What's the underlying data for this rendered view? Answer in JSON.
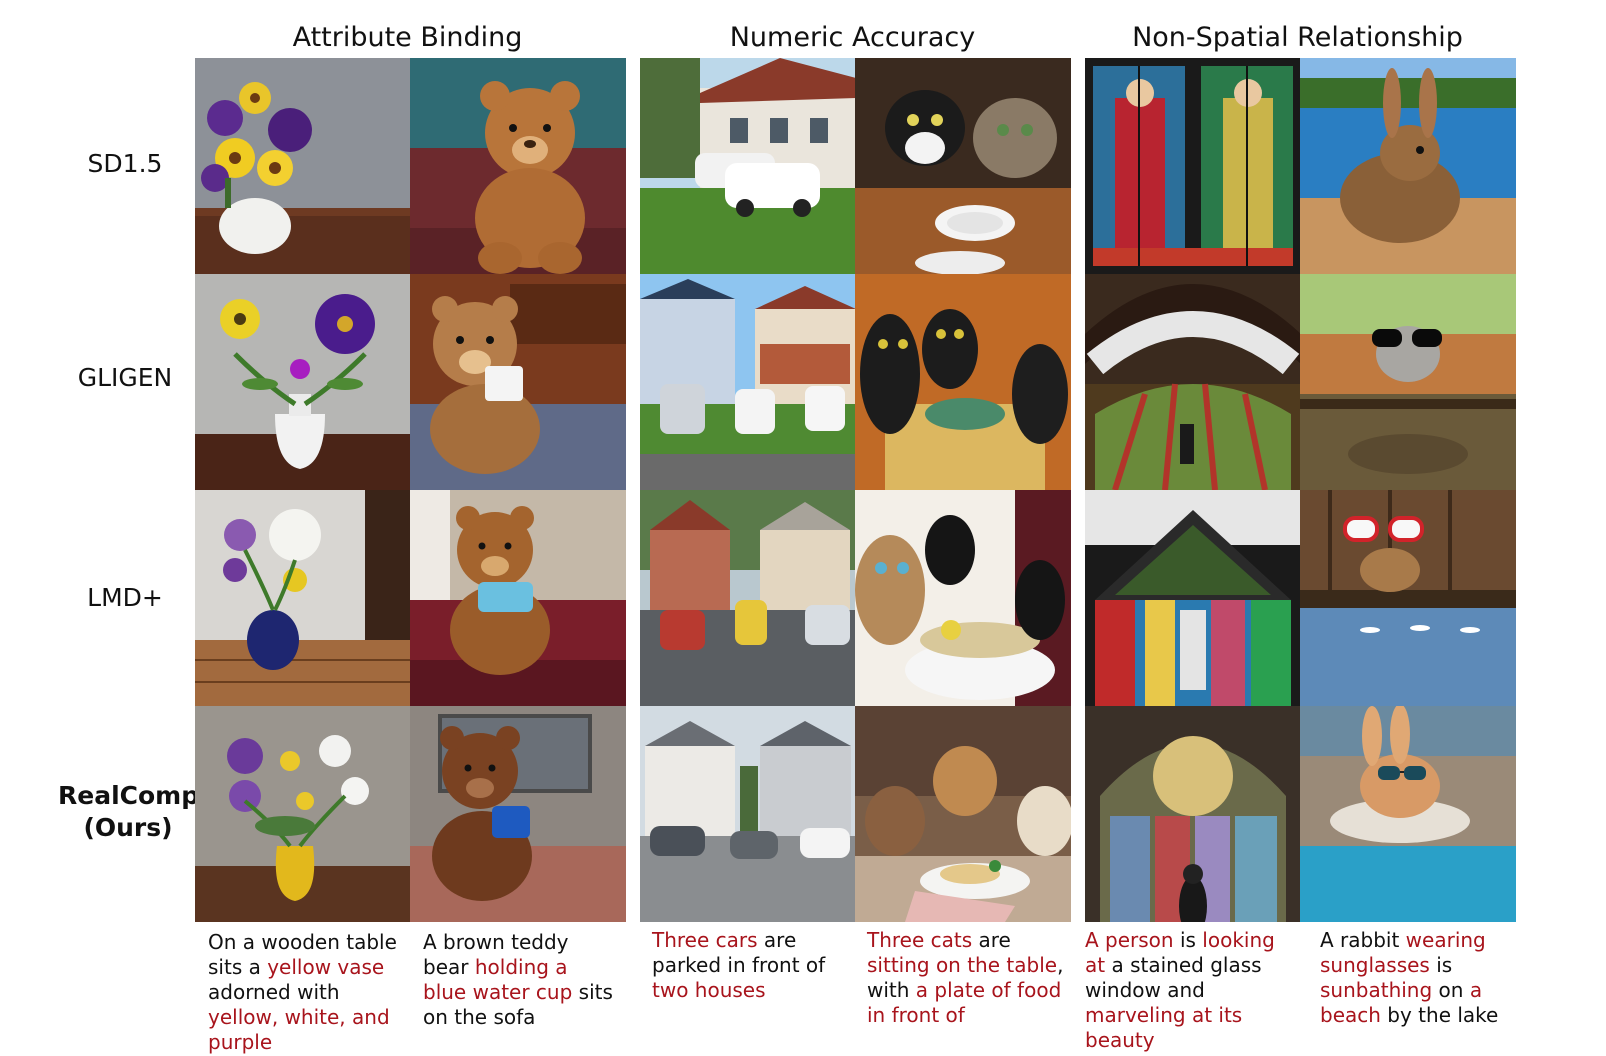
{
  "columns": [
    {
      "title": "Attribute Binding"
    },
    {
      "title": "Numeric Accuracy"
    },
    {
      "title": "Non-Spatial Relationship"
    }
  ],
  "rows": [
    {
      "label": "SD1.5"
    },
    {
      "label": "GLIGEN"
    },
    {
      "label": "LMD+"
    },
    {
      "label_line1": "RealCompo",
      "label_line2": "(Ours)"
    }
  ],
  "captions": [
    {
      "segments": [
        {
          "text": "On a wooden table sits a ",
          "hl": false
        },
        {
          "text": "yellow vase",
          "hl": true
        },
        {
          "text": " adorned with ",
          "hl": false
        },
        {
          "text": "yellow, white, and purple",
          "hl": true
        }
      ]
    },
    {
      "segments": [
        {
          "text": "A brown teddy bear ",
          "hl": false
        },
        {
          "text": "holding a blue water cup",
          "hl": true
        },
        {
          "text": " sits on the sofa",
          "hl": false
        }
      ]
    },
    {
      "segments": [
        {
          "text": "Three cars",
          "hl": true
        },
        {
          "text": " are parked in front of ",
          "hl": false
        },
        {
          "text": "two houses",
          "hl": true
        }
      ]
    },
    {
      "segments": [
        {
          "text": "Three cats",
          "hl": true
        },
        {
          "text": " are ",
          "hl": false
        },
        {
          "text": "sitting on the table",
          "hl": true
        },
        {
          "text": ", with ",
          "hl": false
        },
        {
          "text": "a plate of food in front of",
          "hl": true
        }
      ]
    },
    {
      "segments": [
        {
          "text": "A person",
          "hl": true
        },
        {
          "text": " is ",
          "hl": false
        },
        {
          "text": "looking at",
          "hl": true
        },
        {
          "text": " a stained glass window and ",
          "hl": false
        },
        {
          "text": "marveling at its beauty",
          "hl": true
        }
      ]
    },
    {
      "segments": [
        {
          "text": "A rabbit ",
          "hl": false
        },
        {
          "text": "wearing sunglasses",
          "hl": true
        },
        {
          "text": " is ",
          "hl": false
        },
        {
          "text": "sunbathing",
          "hl": true
        },
        {
          "text": " on ",
          "hl": false
        },
        {
          "text": "a beach",
          "hl": true
        },
        {
          "text": " by the lake",
          "hl": false
        }
      ]
    }
  ],
  "colors": {
    "highlight": "#a8141c",
    "text": "#111111"
  }
}
